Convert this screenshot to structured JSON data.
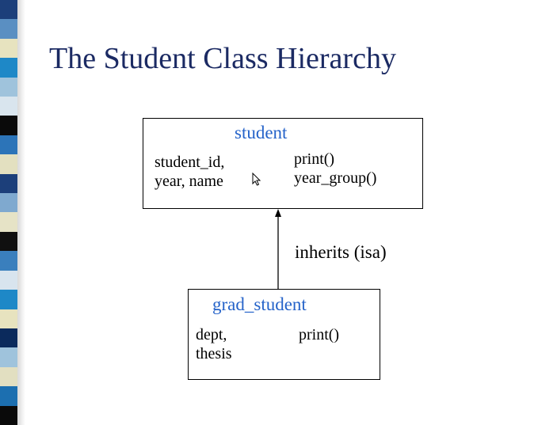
{
  "slide": {
    "title": "The Student Class Hierarchy",
    "stripe_colors": [
      "#1c3f7a",
      "#5a8fc2",
      "#e7e3bf",
      "#1e88c7",
      "#9fc3dc",
      "#d9e5ee",
      "#0a0a0a",
      "#2c74b8",
      "#e3e0c0",
      "#1c3f7a",
      "#7fa9cf",
      "#e6e3c6",
      "#101010",
      "#3a7fbd",
      "#d8e4ee",
      "#1e88c7",
      "#e7e3bf",
      "#0b2a5c",
      "#9fc3dc",
      "#e2dfc1",
      "#1c6fb0",
      "#0a0a0a"
    ]
  },
  "diagram": {
    "student": {
      "name": "student",
      "attributes": [
        "student_id,",
        "year, name"
      ],
      "methods": [
        "print()",
        "year_group()"
      ]
    },
    "grad_student": {
      "name": "grad_student",
      "attributes": [
        "dept,",
        "thesis"
      ],
      "methods": [
        "print()"
      ]
    },
    "relation_label": "inherits (isa)"
  },
  "colors": {
    "title": "#1b2a63",
    "class_name": "#2563c9"
  }
}
